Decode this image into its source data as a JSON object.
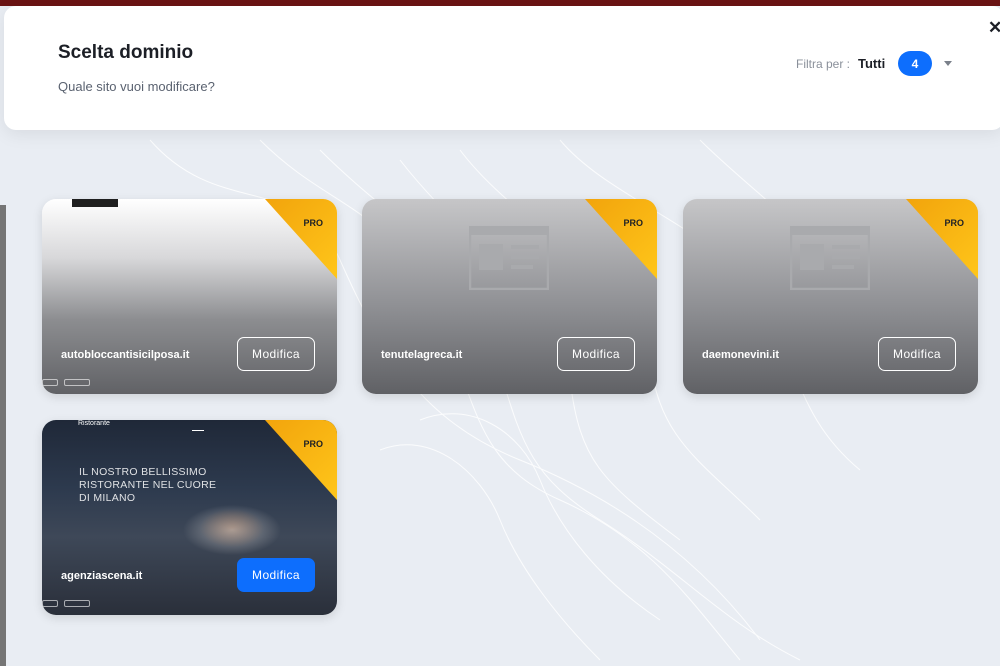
{
  "modal": {
    "title": "Scelta dominio",
    "subtitle": "Quale sito vuoi modificare?"
  },
  "filter": {
    "label": "Filtra per :",
    "value": "Tutti",
    "count": "4"
  },
  "sites": [
    {
      "domain": "autobloccantisicilposa.it",
      "badge": "PRO",
      "action": "Modifica"
    },
    {
      "domain": "tenutelagreca.it",
      "badge": "PRO",
      "action": "Modifica"
    },
    {
      "domain": "daemonevini.it",
      "badge": "PRO",
      "action": "Modifica"
    },
    {
      "domain": "agenziascena.it",
      "badge": "PRO",
      "action": "Modifica",
      "preview": {
        "hero": "IL NOSTRO BELLISSIMO RISTORANTE NEL CUORE DI MILANO",
        "brand": "Ristorante"
      }
    }
  ],
  "colors": {
    "accent": "#0d6efd",
    "pro_ribbon": "#ffc61a",
    "backdrop": "#e9edf3"
  },
  "icons": {
    "close": "close-icon",
    "chevron": "chevron-down-icon",
    "placeholder": "website-placeholder-icon"
  }
}
